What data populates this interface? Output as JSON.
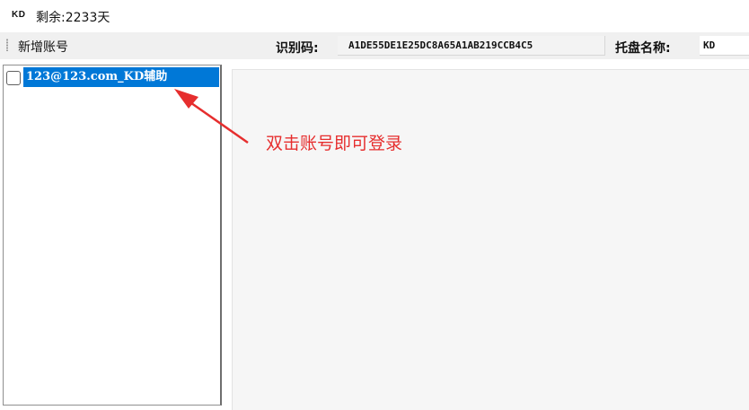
{
  "window": {
    "logo": "KD",
    "title": "剩余:2233天"
  },
  "toolbar": {
    "add_account_label": "新增账号",
    "id_label": "识别码:",
    "id_value": "A1DE55DE1E25DC8A65A1AB219CCB4C5",
    "tray_label": "托盘名称:",
    "tray_value": "KD"
  },
  "account_list": {
    "items": [
      {
        "label": "123@123.com_KD辅助",
        "checked": false,
        "selected": true
      }
    ]
  },
  "annotation": {
    "text": "双击账号即可登录",
    "color": "#e62e2e"
  },
  "colors": {
    "selection": "#0078d7",
    "toolbar_bg": "#f0f0f0",
    "panel_bg": "#f6f6f6"
  }
}
